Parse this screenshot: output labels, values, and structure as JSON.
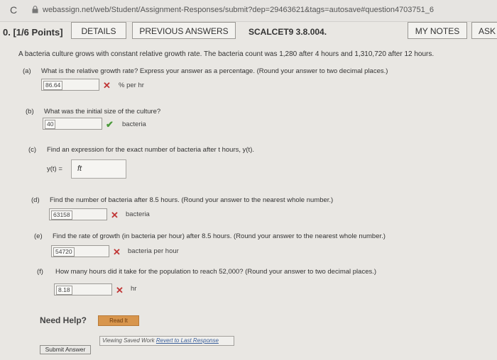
{
  "browser": {
    "url": "webassign.net/web/Student/Assignment-Responses/submit?dep=29463621&tags=autosave#question4703751_6"
  },
  "header": {
    "question_number": "0. [1/6 Points]",
    "details_label": "DETAILS",
    "previous_answers_label": "PREVIOUS ANSWERS",
    "course_label": "SCALCET9 3.8.004.",
    "my_notes_label": "MY NOTES",
    "ask_label": "ASK"
  },
  "problem": {
    "statement": "A bacteria culture grows with constant relative growth rate. The bacteria count was 1,280 after 4 hours and 1,310,720 after 12 hours."
  },
  "parts": {
    "a": {
      "letter": "(a)",
      "question": "What is the relative growth rate? Express your answer as a percentage. (Round your answer to two decimal places.)",
      "answer": "86.64",
      "unit": "% per hr",
      "status": "incorrect"
    },
    "b": {
      "letter": "(b)",
      "question": "What was the initial size of the culture?",
      "answer": "40",
      "unit": "bacteria",
      "status": "correct"
    },
    "c": {
      "letter": "(c)",
      "question": "Find an expression for the exact number of bacteria after t hours, y(t).",
      "answer_label": "y(t) =",
      "answer": "ft"
    },
    "d": {
      "letter": "(d)",
      "question": "Find the number of bacteria after 8.5 hours. (Round your answer to the nearest whole number.)",
      "answer": "63158",
      "unit": "bacteria",
      "status": "incorrect"
    },
    "e": {
      "letter": "(e)",
      "question": "Find the rate of growth (in bacteria per hour) after 8.5 hours. (Round your answer to the nearest whole number.)",
      "answer": "54720",
      "unit": "bacteria per hour",
      "status": "incorrect"
    },
    "f": {
      "letter": "(f)",
      "question": "How many hours did it take for the population to reach 52,000? (Round your answer to two decimal places.)",
      "answer": "8.18",
      "unit": "hr",
      "status": "incorrect"
    }
  },
  "icons": {
    "incorrect": "✕",
    "correct": "✔",
    "reload": "C"
  },
  "footer": {
    "need_help_label": "Need Help?",
    "read_it_label": "Read It",
    "saved_work_prefix": "Viewing Saved Work ",
    "saved_work_link": "Revert to Last Response",
    "submit_label": "Submit Answer"
  },
  "colors": {
    "incorrect": "#c03535",
    "correct": "#4a9a3a",
    "read_it": "#d8964d"
  }
}
